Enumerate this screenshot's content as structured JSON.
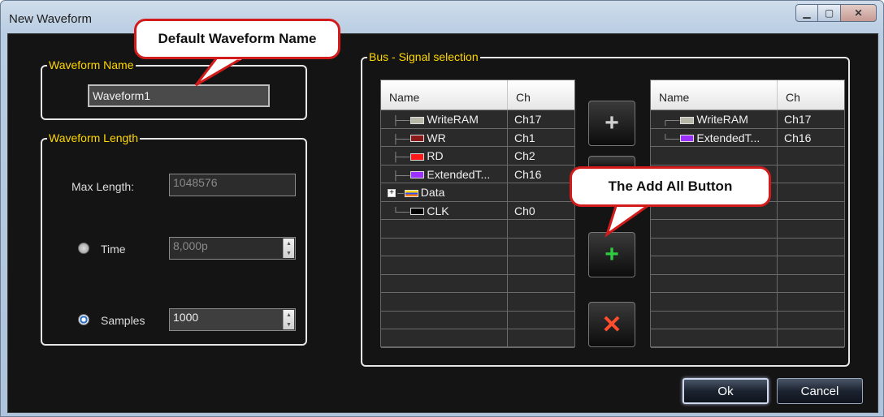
{
  "window": {
    "title": "New Waveform",
    "controls": [
      "minimize-icon",
      "maximize-icon",
      "close-icon"
    ]
  },
  "waveform_name": {
    "group_title": "Waveform Name",
    "value": "Waveform1"
  },
  "waveform_length": {
    "group_title": "Waveform Length",
    "max_length_label": "Max Length:",
    "max_length_value": "1048576",
    "time_label": "Time",
    "time_value": "8,000p",
    "samples_label": "Samples",
    "samples_value": "1000",
    "selected": "Samples"
  },
  "bus_selection": {
    "group_title": "Bus - Signal selection",
    "columns": [
      "Name",
      "Ch"
    ],
    "available": [
      {
        "name": "WriteRAM",
        "ch": "Ch17",
        "color": "#b8b8a8",
        "tree": "├─"
      },
      {
        "name": "WR",
        "ch": "Ch1",
        "color": "#8b1a1a",
        "tree": "├─"
      },
      {
        "name": "RD",
        "ch": "Ch2",
        "color": "#ff1a1a",
        "tree": "├─"
      },
      {
        "name": "ExtendedT...",
        "ch": "Ch16",
        "color": "#9b30ff",
        "tree": "├─"
      },
      {
        "name": "Data",
        "ch": "",
        "color": "bus",
        "tree": "plus"
      },
      {
        "name": "CLK",
        "ch": "Ch0",
        "color": "#000000",
        "tree": "└─"
      }
    ],
    "selected": [
      {
        "name": "WriteRAM",
        "ch": "Ch17",
        "color": "#b8b8a8",
        "tree": "┌─"
      },
      {
        "name": "ExtendedT...",
        "ch": "Ch16",
        "color": "#9b30ff",
        "tree": "└─"
      }
    ],
    "buttons": {
      "add": "+",
      "add_all": "+",
      "remove": "✕"
    }
  },
  "footer": {
    "ok_label": "Ok",
    "cancel_label": "Cancel"
  },
  "callouts": {
    "name_callout": "Default Waveform Name",
    "add_all_callout": "The Add All Button"
  },
  "colors": {
    "accent_title": "#ffd700",
    "callout_border": "#d21c1c",
    "add_all_green": "#2ecc40",
    "remove_red": "#ff4d2e"
  }
}
